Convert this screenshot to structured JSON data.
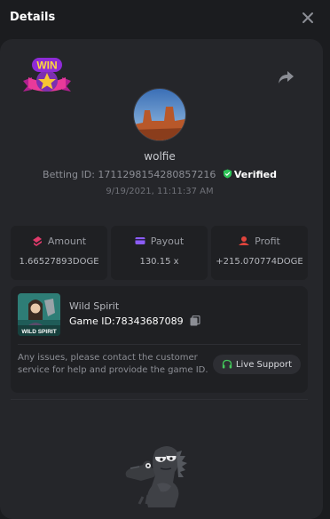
{
  "header": {
    "title": "Details"
  },
  "badge": {
    "text": "WIN"
  },
  "user": {
    "name": "wolfie",
    "betting_id_label": "Betting ID:",
    "betting_id": "1711298154280857216",
    "verified_label": "Verified",
    "timestamp": "9/19/2021, 11:11:37 AM"
  },
  "stats": [
    {
      "label": "Amount",
      "value": "1.66527893DOGE",
      "icon": "amount-icon"
    },
    {
      "label": "Payout",
      "value": "130.15 x",
      "icon": "card-icon"
    },
    {
      "label": "Profit",
      "value": "+215.070774DOGE",
      "icon": "profit-icon"
    }
  ],
  "game": {
    "name": "Wild Spirit",
    "thumb_text": "WILD SPIRIT",
    "id_label": "Game ID:",
    "id": "78343687089",
    "issue_text": "Any issues, please contact the customer service for help and proviode the game ID.",
    "support_label": "Live Support"
  },
  "colors": {
    "background": "#1b1c1f",
    "panel": "#25262a",
    "card": "#1f2023",
    "accent_pink": "#e03a6b",
    "accent_purple": "#8b5cf6",
    "accent_red": "#e0443c",
    "verified_green": "#2ec458",
    "support_green": "#43c65a"
  }
}
